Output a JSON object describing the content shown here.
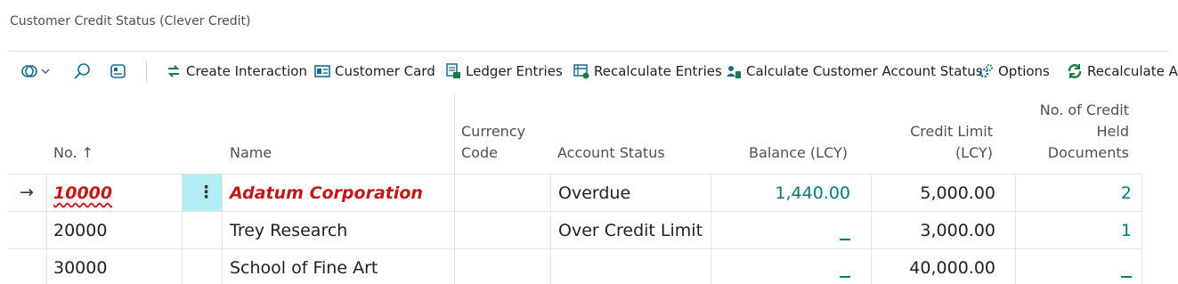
{
  "page": {
    "title": "Customer Credit Status (Clever Credit)"
  },
  "colors": {
    "accent": "#047b6b",
    "highlight_red": "#c21818",
    "selection": "#b3ecf2"
  },
  "toolbar": {
    "icons": [
      "views-icon",
      "search-icon",
      "filter-pane-icon"
    ],
    "actions": [
      {
        "label": "Create Interaction",
        "icon": "create-interaction-icon"
      },
      {
        "label": "Customer Card",
        "icon": "customer-card-icon"
      },
      {
        "label": "Ledger Entries",
        "icon": "ledger-entries-icon"
      },
      {
        "label": "Recalculate Entries",
        "icon": "recalculate-entries-icon"
      },
      {
        "label": "Calculate Customer Account Status",
        "icon": "calculate-status-icon"
      },
      {
        "label": "Options",
        "icon": "options-icon"
      },
      {
        "label": "Recalculate All",
        "icon": "recalculate-all-icon"
      }
    ]
  },
  "table": {
    "headers": {
      "no": "No. ↑",
      "name": "Name",
      "currency_1": "Currency",
      "currency_2": "Code",
      "status": "Account Status",
      "balance": "Balance (LCY)",
      "limit_1": "Credit Limit",
      "limit_2": "(LCY)",
      "held_1": "No. of Credit",
      "held_2": "Held",
      "held_3": "Documents"
    },
    "rows": [
      {
        "no": "10000",
        "name": "Adatum Corporation",
        "currency": "",
        "status": "Overdue",
        "balance": "1,440.00",
        "limit": "5,000.00",
        "held": "2",
        "row_marker": "→",
        "menu": "⋮"
      },
      {
        "no": "20000",
        "name": "Trey Research",
        "currency": "",
        "status": "Over Credit Limit",
        "balance": "",
        "limit": "3,000.00",
        "held": "1"
      },
      {
        "no": "30000",
        "name": "School of Fine Art",
        "currency": "",
        "status": "",
        "balance": "",
        "limit": "40,000.00",
        "held": ""
      }
    ]
  }
}
